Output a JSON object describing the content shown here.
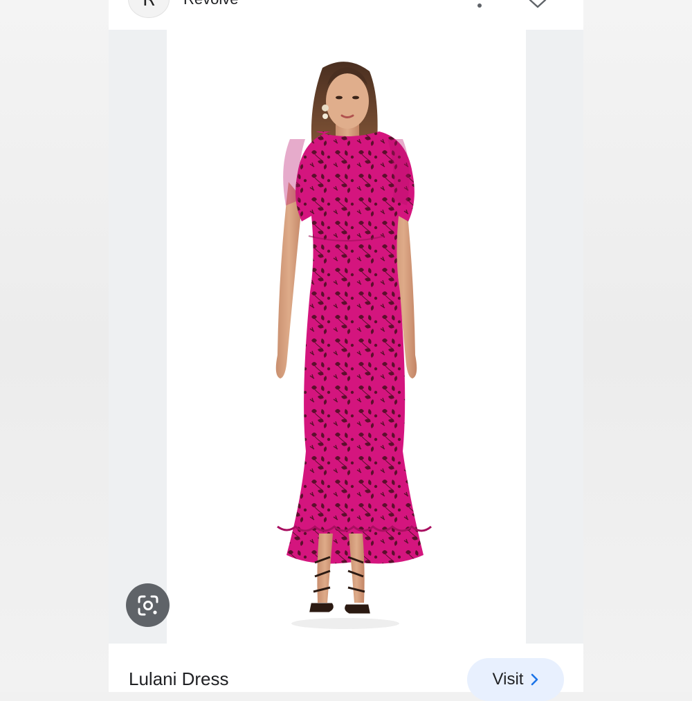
{
  "header": {
    "source_initial": "R",
    "source_name": "Revolve",
    "more_icon": "more-vert-icon",
    "close_icon": "close-icon"
  },
  "image": {
    "subject": "Model wearing a pink floral print short-sleeve midi dress with flared hem and strappy heels",
    "dress_color": "#d4157e",
    "print_color": "#5b0f2c"
  },
  "lens": {
    "icon": "google-lens-icon"
  },
  "footer": {
    "product_title": "Lulani Dress",
    "visit_label": "Visit",
    "visit_icon": "chevron-right-icon",
    "accent_color": "#1a73e8"
  }
}
